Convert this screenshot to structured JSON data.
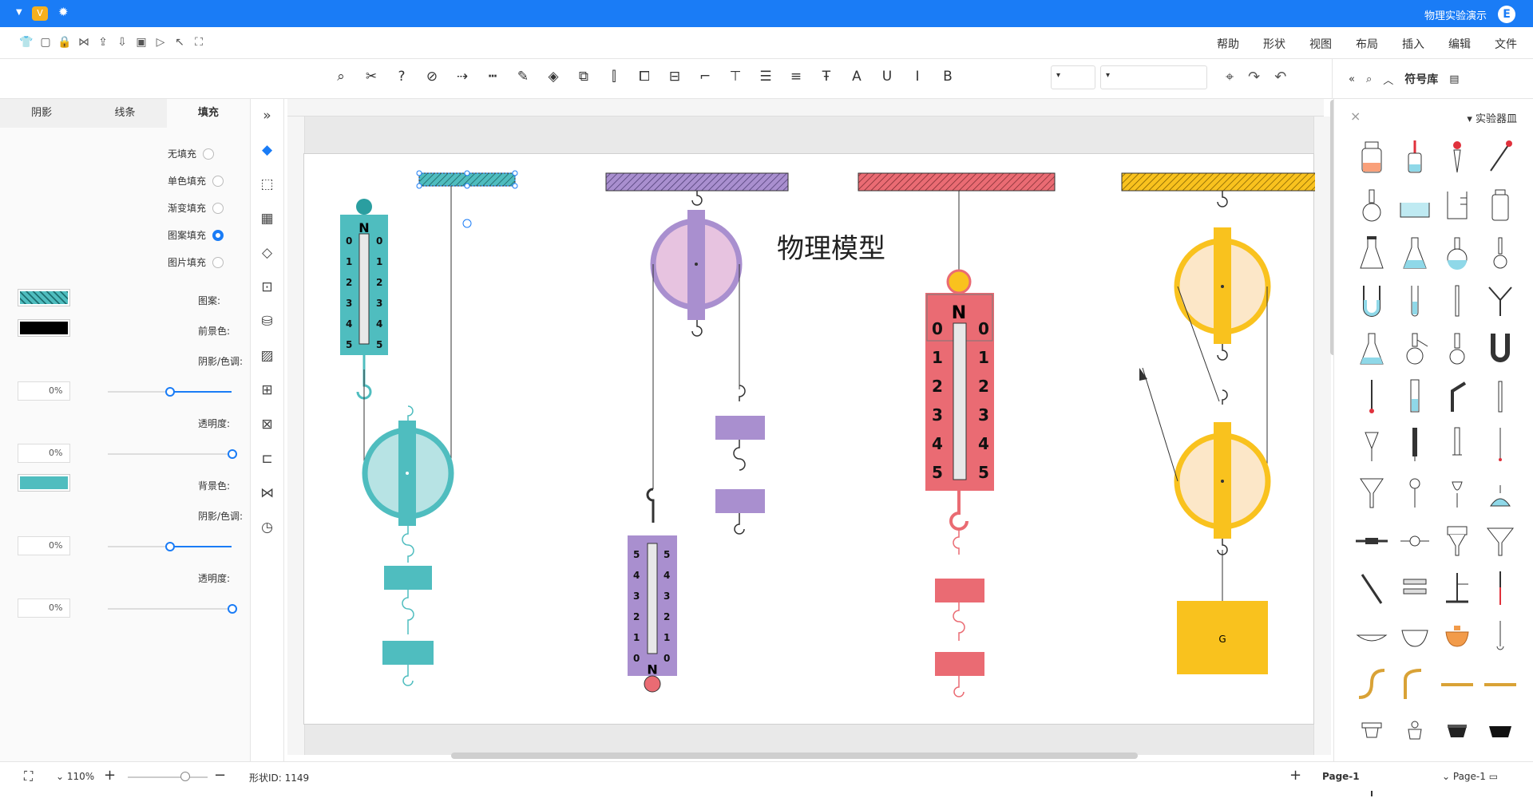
{
  "app": {
    "title": "物理实验演示"
  },
  "menu": {
    "items": [
      "文件",
      "编辑",
      "插入",
      "布局",
      "视图",
      "形状",
      "帮助"
    ]
  },
  "toolbar": {
    "font_placeholder": "",
    "size_placeholder": ""
  },
  "library": {
    "title": "符号库",
    "category": "实验器皿"
  },
  "left_panel": {
    "tabs": [
      "填充",
      "线条",
      "阴影"
    ],
    "fill_options": [
      {
        "label": "无填充",
        "selected": false
      },
      {
        "label": "单色填充",
        "selected": false
      },
      {
        "label": "渐变填充",
        "selected": false
      },
      {
        "label": "图案填充",
        "selected": true
      },
      {
        "label": "图片填充",
        "selected": false
      }
    ],
    "pattern_label": "图案:",
    "fg_label": "前景色:",
    "shade1_label": "阴影/色调:",
    "shade1_value": "0%",
    "trans1_label": "透明度:",
    "trans1_value": "0%",
    "bg_label": "背景色:",
    "shade2_label": "阴影/色调:",
    "shade2_value": "0%",
    "trans2_label": "透明度:",
    "trans2_value": "0%",
    "colors": {
      "pattern": "#4fbdbf",
      "fg": "#000000",
      "bg": "#4fbdbf"
    }
  },
  "canvas": {
    "title": "物理模型",
    "weight_label": "G",
    "spring_scale": {
      "top_letter": "N",
      "ticks": [
        "0",
        "1",
        "2",
        "3",
        "4",
        "5"
      ]
    },
    "colors": {
      "teal": "#4fbdbf",
      "purple": "#a98fcf",
      "red": "#ea6b73",
      "yellow": "#f9c21e"
    }
  },
  "status": {
    "page_tab": "Page-1",
    "page_name": "Page-1",
    "shape_id": "形状ID: 1149",
    "zoom": "110%"
  }
}
